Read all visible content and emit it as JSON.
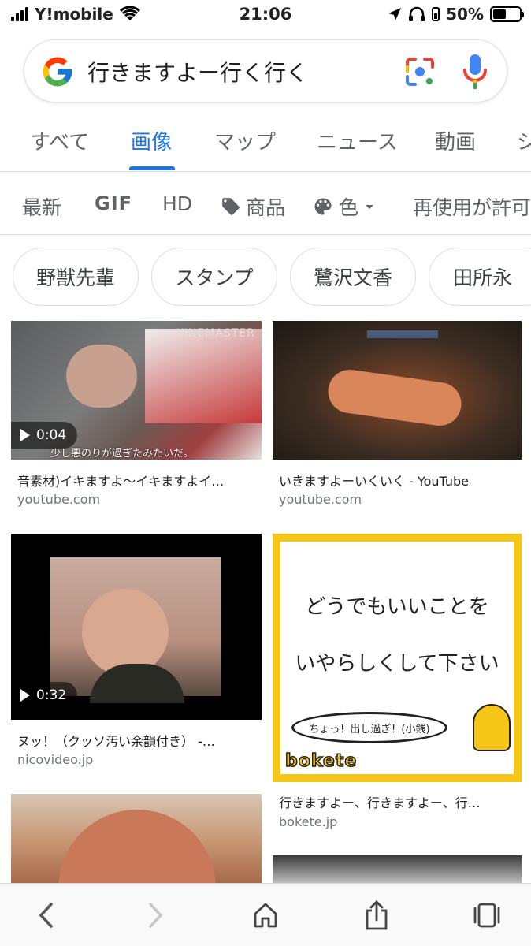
{
  "status": {
    "carrier": "Y!mobile",
    "time": "21:06",
    "battery": "50%",
    "battery_level": 0.5
  },
  "search": {
    "query": "行きますよー行く行く"
  },
  "tabs": [
    {
      "label": "すべて",
      "active": false
    },
    {
      "label": "画像",
      "active": true
    },
    {
      "label": "マップ",
      "active": false
    },
    {
      "label": "ニュース",
      "active": false
    },
    {
      "label": "動画",
      "active": false
    },
    {
      "label": "シ",
      "active": false
    }
  ],
  "filters": {
    "latest": "最新",
    "gif": "GIF",
    "hd": "HD",
    "products": "商品",
    "color": "色",
    "reuse": "再使用が許可"
  },
  "chips": [
    "野獣先輩",
    "スタンプ",
    "鷺沢文香",
    "田所永"
  ],
  "results": [
    {
      "title": "音素材)イキますよ〜イキますよイ…",
      "source": "youtube.com",
      "duration": "0:04",
      "overlay_brand": "KINEMASTER",
      "overlay_caption": "少し悪のりが過ぎたみたいだ。"
    },
    {
      "title": "いきますよーいくいく - YouTube",
      "source": "youtube.com"
    },
    {
      "title": "ヌッ！（クッソ汚い余韻付き） -…",
      "source": "nicovideo.jp",
      "duration": "0:32"
    },
    {
      "title": "行きますよー、行きますよー、行…",
      "source": "bokete.jp",
      "card_line1": "どうでもいいことを",
      "card_line2": "いやらしくして下さい",
      "card_bubble": "ちょっ！出し過ぎ！(小銭)",
      "card_logo": "bokete"
    }
  ],
  "colors": {
    "accent": "#1a73e8",
    "bokete_yellow": "#f5c518"
  }
}
